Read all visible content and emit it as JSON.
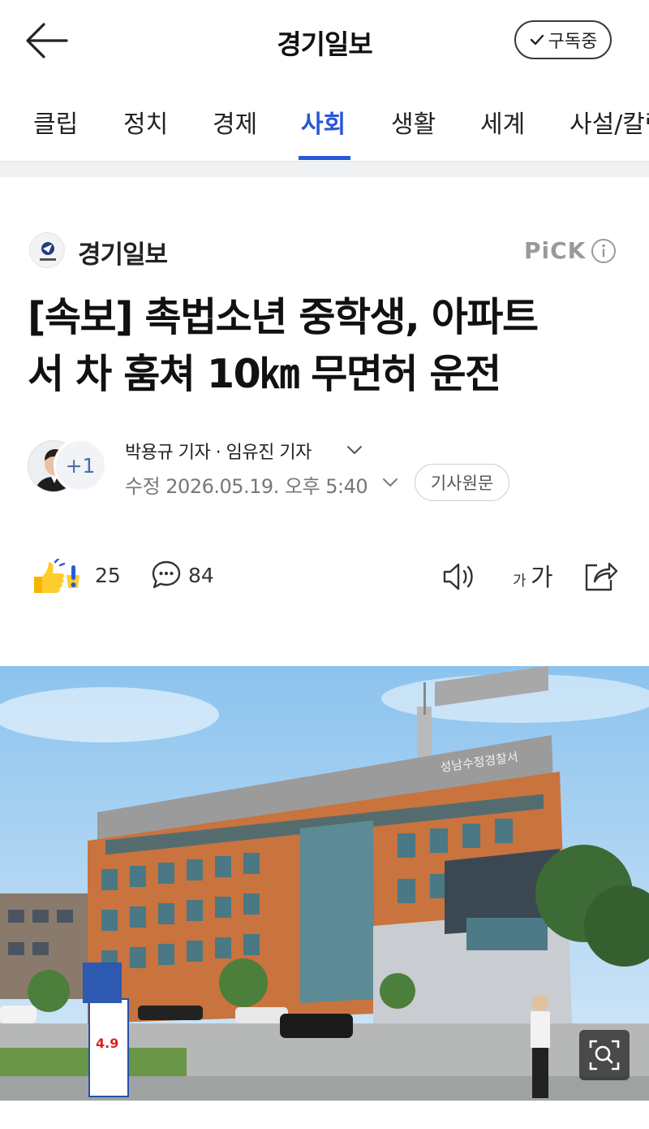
{
  "header": {
    "title": "경기일보",
    "subscribe_label": "구독중"
  },
  "tabs": [
    {
      "label": "클립",
      "active": false
    },
    {
      "label": "정치",
      "active": false
    },
    {
      "label": "경제",
      "active": false
    },
    {
      "label": "사회",
      "active": true
    },
    {
      "label": "생활",
      "active": false
    },
    {
      "label": "세계",
      "active": false
    },
    {
      "label": "사설/칼럼",
      "active": false
    }
  ],
  "publisher": {
    "name": "경기일보",
    "pick_label": "PiCK"
  },
  "article": {
    "headline_line1": "[속보] 촉법소년 중학생, 아파트",
    "headline_line2": "서 차 훔쳐 10㎞ 무면허 운전",
    "reporters": "박용규 기자 · 임유진 기자",
    "extra_reporters": "+1",
    "date_line": "수정 2026.05.19. 오후 5:40",
    "original_button": "기사원문"
  },
  "actions": {
    "reaction_count": "25",
    "comment_count": "84",
    "font_small": "가",
    "font_big": "가"
  },
  "photo": {
    "sign_text": "성남수정경찰서",
    "banner_text": "4.9"
  },
  "colors": {
    "accent": "#2b57d6",
    "band": "#eef0f2"
  }
}
